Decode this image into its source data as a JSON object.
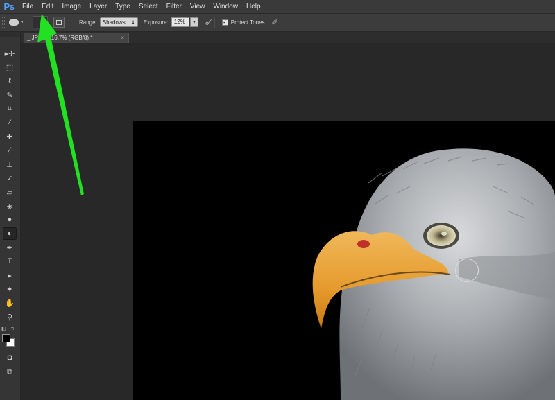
{
  "app": {
    "logo": "Ps"
  },
  "menu": [
    "File",
    "Edit",
    "Image",
    "Layer",
    "Type",
    "Select",
    "Filter",
    "View",
    "Window",
    "Help"
  ],
  "options": {
    "range_label": "Range:",
    "range_value": "Shadows",
    "exposure_label": "Exposure:",
    "exposure_value": "12%",
    "protect_tones_label": "Protect Tones",
    "protect_tones_checked": true
  },
  "document": {
    "tab_title": "_.JPG @ 16.7% (RGB/8) *",
    "close_glyph": "×"
  },
  "tools": [
    "move-tool",
    "marquee-tool",
    "lasso-tool",
    "quick-selection-tool",
    "crop-tool",
    "eyedropper-tool",
    "spot-healing-tool",
    "brush-tool",
    "clone-stamp-tool",
    "history-brush-tool",
    "eraser-tool",
    "paint-bucket-tool",
    "blur-tool",
    "dodge-tool",
    "pen-tool",
    "type-tool",
    "path-selection-tool",
    "shape-tool",
    "hand-tool",
    "zoom-tool"
  ],
  "active_tool": "dodge-tool",
  "colors": {
    "foreground": "#000000",
    "background": "#ffffff",
    "annotation_arrow": "#22e022"
  }
}
